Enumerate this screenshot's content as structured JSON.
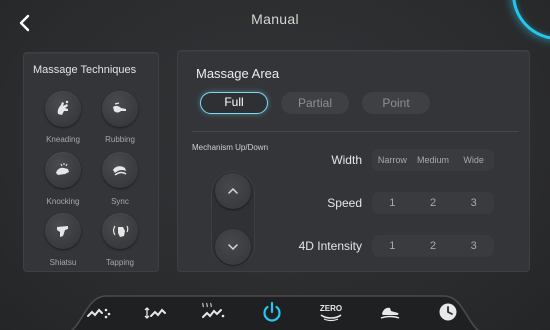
{
  "header": {
    "title": "Manual",
    "back_icon": "chevron-left-icon"
  },
  "accent_color": "#27c6ee",
  "techniques": {
    "title": "Massage Techniques",
    "items": [
      {
        "label": "Kneading",
        "icon": "kneading-hand-icon"
      },
      {
        "label": "Rubbing",
        "icon": "rubbing-hand-icon"
      },
      {
        "label": "Knocking",
        "icon": "knocking-hand-icon"
      },
      {
        "label": "Sync",
        "icon": "sync-hand-icon"
      },
      {
        "label": "Shiatsu",
        "icon": "shiatsu-hand-icon"
      },
      {
        "label": "Tapping",
        "icon": "tapping-hand-icon"
      }
    ]
  },
  "area": {
    "title": "Massage Area",
    "options": [
      "Full",
      "Partial",
      "Point"
    ],
    "selected": "Full",
    "mechanism_label": "Mechanism Up/Down",
    "width": {
      "label": "Width",
      "options": [
        "Narrow",
        "Medium",
        "Wide"
      ]
    },
    "speed": {
      "label": "Speed",
      "options": [
        "1",
        "2",
        "3"
      ]
    },
    "intensity": {
      "label": "4D Intensity",
      "options": [
        "1",
        "2",
        "3"
      ]
    }
  },
  "nav": {
    "items": [
      {
        "icon": "wave-dots-icon"
      },
      {
        "icon": "wave-arrows-icon"
      },
      {
        "icon": "heat-wave-icon"
      },
      {
        "icon": "power-icon",
        "active": true
      },
      {
        "icon": "zero-gravity-icon",
        "text": "ZERO"
      },
      {
        "icon": "foot-rest-icon"
      },
      {
        "icon": "clock-icon"
      }
    ]
  }
}
